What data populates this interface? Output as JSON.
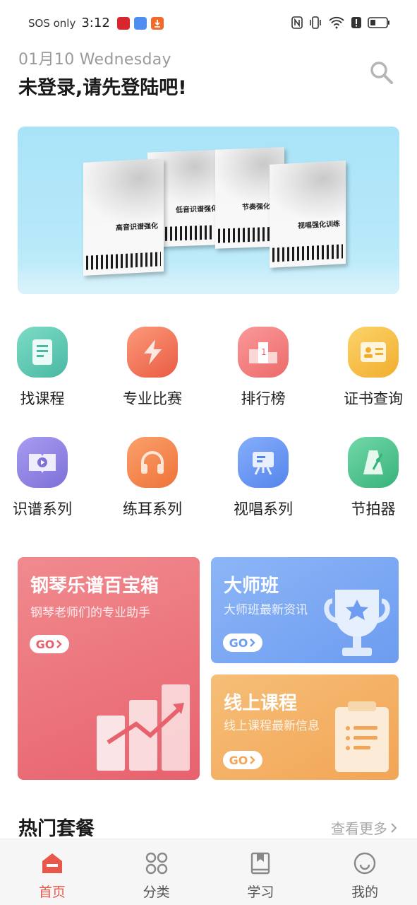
{
  "status_bar": {
    "carrier": "SOS only",
    "time": "3:12",
    "icons": [
      "app-red-icon",
      "app-blue-icon",
      "download-app-icon",
      "nfc-icon",
      "vibrate-icon",
      "wifi-icon",
      "alert-icon",
      "battery-icon"
    ]
  },
  "header": {
    "date": "01月10 Wednesday",
    "greeting": "未登录,请先登陆吧!"
  },
  "banner": {
    "books": [
      "高音识谱强化",
      "低音识谱强化",
      "节奏强化",
      "视唱强化训练"
    ]
  },
  "grid": [
    {
      "label": "找课程",
      "icon": "book-icon",
      "color": "#5cc7b2"
    },
    {
      "label": "专业比赛",
      "icon": "lightning-icon",
      "color": "#f0735a"
    },
    {
      "label": "排行榜",
      "icon": "podium-icon",
      "color": "#f07a7a"
    },
    {
      "label": "证书查询",
      "icon": "id-card-icon",
      "color": "#f5b942"
    },
    {
      "label": "识谱系列",
      "icon": "video-book-icon",
      "color": "#8d82e0"
    },
    {
      "label": "练耳系列",
      "icon": "headphones-icon",
      "color": "#f2804a"
    },
    {
      "label": "视唱系列",
      "icon": "easel-icon",
      "color": "#5f8ef0"
    },
    {
      "label": "节拍器",
      "icon": "metronome-icon",
      "color": "#45c08b"
    }
  ],
  "cards": {
    "piano": {
      "title": "钢琴乐谱百宝箱",
      "subtitle": "钢琴老师们的专业助手",
      "go": "GO"
    },
    "master": {
      "title": "大师班",
      "subtitle": "大师班最新资讯",
      "go": "GO"
    },
    "online": {
      "title": "线上课程",
      "subtitle": "线上课程最新信息",
      "go": "GO"
    }
  },
  "hot": {
    "title": "热门套餐",
    "more": "查看更多"
  },
  "nav": [
    {
      "label": "首页",
      "icon": "home-icon",
      "active": true
    },
    {
      "label": "分类",
      "icon": "category-icon",
      "active": false
    },
    {
      "label": "学习",
      "icon": "study-book-icon",
      "active": false
    },
    {
      "label": "我的",
      "icon": "profile-icon",
      "active": false
    }
  ],
  "colors": {
    "accent": "#e8584a",
    "piano_card": "#ea6a77",
    "master_card": "#6f9ff0",
    "online_card": "#f2ab5b"
  }
}
